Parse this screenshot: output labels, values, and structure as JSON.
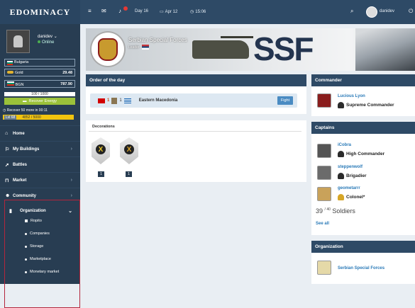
{
  "header": {
    "brand": "EDOMINACY",
    "day": "Day 16",
    "date": "Apr 12",
    "time": "15:06",
    "username": "danidev"
  },
  "profile": {
    "name": "danidev",
    "status": "Online",
    "country": "Bulgaria"
  },
  "resources": {
    "gold_label": "Gold",
    "gold_value": "29.48",
    "currency_label": "BGN",
    "currency_value": "787.90"
  },
  "energy": {
    "bar_text": "100 / 1000",
    "recover_label": "Recover Energy",
    "recover_note": "Recover 50 more in 00:11",
    "level_label": "Lvl 68",
    "xp_text": "4852 / 5000"
  },
  "nav": {
    "home": "Home",
    "buildings": "My Buildings",
    "battles": "Battles",
    "market": "Market",
    "community": "Community",
    "organization": "Organization",
    "sub_items": [
      "Ropito",
      "Companies",
      "Storage",
      "Marketplace",
      "Monetary market"
    ]
  },
  "banner": {
    "title": "Serbian Special Forces",
    "subtitle": "Leader",
    "abbr": "SSF"
  },
  "order": {
    "header": "Order of the day",
    "count_a": "1",
    "count_b": "1",
    "region": "Eastern Macedonia",
    "fight_label": "Fight"
  },
  "decorations": {
    "header": "Decorations",
    "medals": [
      {
        "symbol": "X",
        "count": "1"
      },
      {
        "symbol": "X",
        "count": "1"
      }
    ]
  },
  "commander": {
    "header": "Commander",
    "name": "Lucious Lyon",
    "rank": "Supreme Commander"
  },
  "captains": {
    "header": "Captains",
    "list": [
      {
        "name": "iCobra",
        "rank": "High Commander"
      },
      {
        "name": "steppenwolf",
        "rank": "Brigadier"
      },
      {
        "name": "geometarrr",
        "rank": "Colonel*"
      }
    ],
    "soldier_count": "39",
    "soldier_max": "40",
    "soldier_label": "Soldiers",
    "see_all": "See all"
  },
  "organization": {
    "header": "Organization",
    "name": "Serbian Special Forces"
  },
  "colors": {
    "topbar": "#2e4a66",
    "sidebar": "#283d52",
    "accent": "#2a7ab8",
    "highlight": "#b3263c",
    "energy_green": "#9bc13a"
  }
}
